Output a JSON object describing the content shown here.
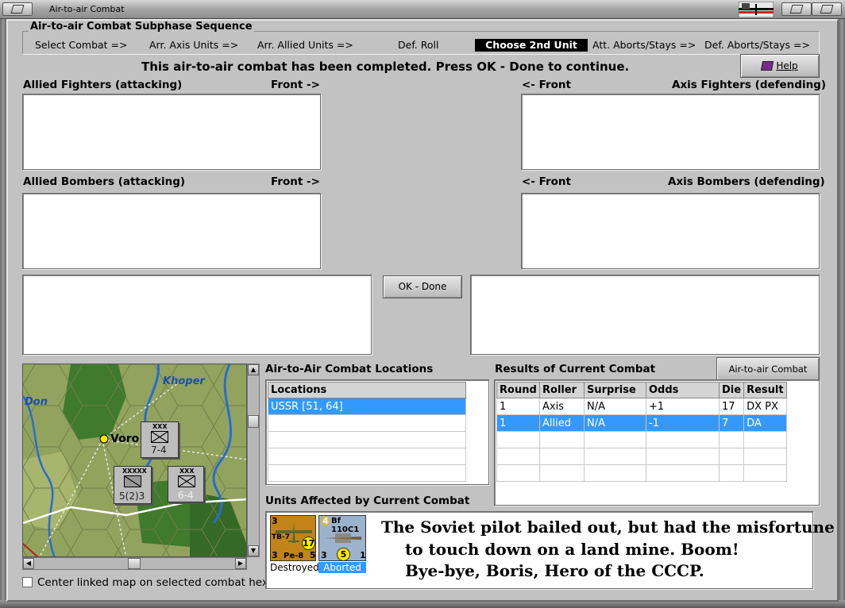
{
  "window": {
    "title": "Air-to-air Combat"
  },
  "subphase": {
    "title": "Air-to-air Combat Subphase Sequence",
    "steps": [
      "Select Combat =>",
      "Arr. Axis Units =>",
      "Arr. Allied Units  =>",
      "Def. Roll",
      "Choose 2nd Unit",
      "Att. Aborts/Stays =>",
      "Def. Aborts/Stays =>"
    ],
    "active_step": "Choose 2nd Unit"
  },
  "status_message": "This air-to-air combat has been completed.  Press OK - Done to continue.",
  "help_button": "Help",
  "panels": {
    "allied_fighters": "Allied Fighters (attacking)",
    "axis_fighters": "Axis Fighters (defending)",
    "allied_bombers": "Allied Bombers (attacking)",
    "axis_bombers": "Axis Bombers (defending)",
    "front_right": "Front ->",
    "front_left": "<- Front"
  },
  "ok_done_button": "OK - Done",
  "map": {
    "labels": {
      "river_khoper": "Khoper",
      "river_don": "Don",
      "city": "Voro"
    },
    "units": [
      {
        "size": "XXX",
        "strength": "7-4"
      },
      {
        "size": "XXXXX",
        "strength": "5(2)3"
      },
      {
        "size": "XXX",
        "strength": "6-4"
      }
    ],
    "center_checkbox_label": "Center linked map on selected combat hex",
    "center_checked": false
  },
  "locations": {
    "title": "Air-to-Air Combat Locations",
    "header": "Locations",
    "rows": [
      "USSR [51, 64]",
      "",
      "",
      "",
      ""
    ],
    "selected_index": 0
  },
  "results": {
    "title": "Results of Current Combat",
    "chart_button": "Air-to-air Combat Chart",
    "columns": [
      "Round",
      "Roller",
      "Surprise",
      "Odds",
      "Die",
      "Result"
    ],
    "rows": [
      [
        "1",
        "Axis",
        "N/A",
        "+1",
        "17",
        "DX PX"
      ],
      [
        "1",
        "Allied",
        "N/A",
        "-1",
        "7",
        "DA"
      ],
      [
        "",
        "",
        "",
        "",
        "",
        ""
      ],
      [
        "",
        "",
        "",
        "",
        "",
        ""
      ],
      [
        "",
        "",
        "",
        "",
        "",
        ""
      ]
    ],
    "selected_index": 1
  },
  "units_affected": {
    "title": "Units Affected by Current Combat",
    "units": [
      {
        "name": "Pe-8",
        "alt": "TB-7",
        "top_left": "3",
        "bottom_left": "3",
        "badge": "17",
        "bottom_right": "5",
        "status": "Destroyed"
      },
      {
        "name": "Bf 110C1",
        "top_left": "4",
        "bottom_left": "3",
        "badge": "5",
        "bottom_right": "1",
        "status": "Aborted"
      }
    ]
  },
  "caption": {
    "line1": "The Soviet pilot bailed out, but had the misfortune",
    "line2": "to touch down on a land mine. Boom!",
    "line3": "Bye-bye, Boris, Hero of the CCCP."
  },
  "colors": {
    "selection": "#3399ff",
    "window_bg": "#c2c2c2",
    "active_step_bg": "#000000"
  }
}
